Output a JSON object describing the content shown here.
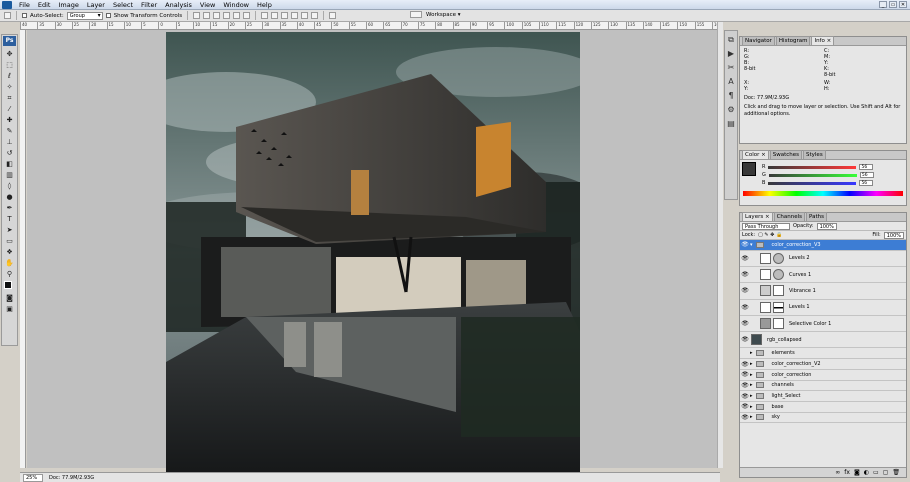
{
  "menu": {
    "items": [
      "File",
      "Edit",
      "Image",
      "Layer",
      "Select",
      "Filter",
      "Analysis",
      "View",
      "Window",
      "Help"
    ]
  },
  "window": {
    "minimize": "_",
    "restore": "▭",
    "close": "✕"
  },
  "options": {
    "auto_select_label": "Auto-Select:",
    "auto_select_value": "Group",
    "transform_label": "Show Transform Controls",
    "workspace_label": "Workspace ▾"
  },
  "ruler": {
    "ticks": [
      "40",
      "35",
      "30",
      "25",
      "20",
      "15",
      "10",
      "5",
      "0",
      "5",
      "10",
      "15",
      "20",
      "25",
      "30",
      "35",
      "40",
      "45",
      "50",
      "55",
      "60",
      "65",
      "70",
      "75",
      "80",
      "85",
      "90",
      "95",
      "100",
      "105",
      "110",
      "115",
      "120",
      "125",
      "130",
      "135",
      "140",
      "145",
      "150",
      "155",
      "160"
    ]
  },
  "status": {
    "zoom": "25%",
    "doc": "Doc: 77.9M/2.93G"
  },
  "info_panel": {
    "tabs": [
      "Navigator",
      "Histogram",
      "Info ×"
    ],
    "r": "R:",
    "g": "G:",
    "b": "B:",
    "c": "C:",
    "m": "M:",
    "y": "Y:",
    "k": "K:",
    "bit_left": "8-bit",
    "bit_right": "8-bit",
    "x": "X:",
    "yy": "Y:",
    "w": "W:",
    "h": "H:",
    "doc": "Doc: 77.9M/2.93G",
    "hint": "Click and drag to move layer or selection. Use Shift and Alt for additional options."
  },
  "color_panel": {
    "tabs": [
      "Color ×",
      "Swatches",
      "Styles"
    ],
    "channels": [
      {
        "name": "R",
        "value": "56"
      },
      {
        "name": "G",
        "value": "56"
      },
      {
        "name": "B",
        "value": "56"
      }
    ],
    "colors": {
      "fg": "#383838",
      "r": "#c81818",
      "g": "#18a818",
      "b": "#1838c8"
    }
  },
  "layers_panel": {
    "tabs": [
      "Layers ×",
      "Channels",
      "Paths"
    ],
    "blend": "Pass Through",
    "opacity_label": "Opacity:",
    "opacity": "100%",
    "lock_label": "Lock:",
    "fill_label": "Fill:",
    "fill": "100%",
    "layers": [
      {
        "name": "color_correction_V3",
        "type": "group",
        "selected": true
      },
      {
        "name": "Levels 2",
        "type": "adjust"
      },
      {
        "name": "Curves 1",
        "type": "adjust"
      },
      {
        "name": "Vibrance 1",
        "type": "adjust"
      },
      {
        "name": "Levels 1",
        "type": "adjust"
      },
      {
        "name": "Selective Color 1",
        "type": "adjust"
      },
      {
        "name": "rgb_collapsed",
        "type": "pixel"
      },
      {
        "name": "elements",
        "type": "folder"
      },
      {
        "name": "color_correction_V2",
        "type": "folder"
      },
      {
        "name": "color_correction",
        "type": "folder"
      },
      {
        "name": "channels",
        "type": "folder"
      },
      {
        "name": "light_Select",
        "type": "folder"
      },
      {
        "name": "base",
        "type": "folder"
      },
      {
        "name": "sky",
        "type": "folder"
      }
    ],
    "bottom_icons": [
      "link-icon",
      "fx-icon",
      "mask-icon",
      "adjustment-icon",
      "folder-icon",
      "new-layer-icon",
      "trash-icon"
    ]
  }
}
